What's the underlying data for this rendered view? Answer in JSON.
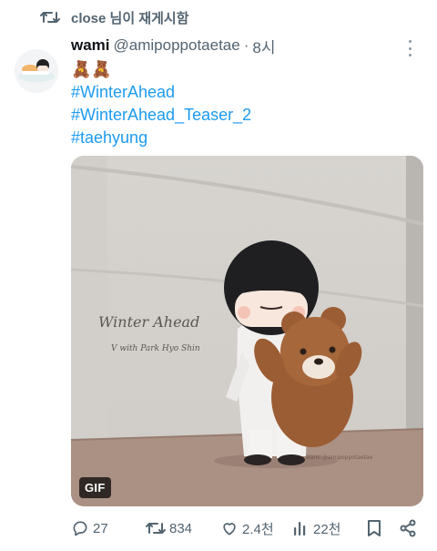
{
  "repost": {
    "text": "close 님이 재게시함"
  },
  "tweet": {
    "author_name": "wami",
    "handle": "@amipoppotaetae",
    "separator": "·",
    "time": "8시",
    "emoji": "🧸🧸",
    "hashtags": [
      "#WinterAhead",
      "#WinterAhead_Teaser_2",
      "#taehyung"
    ]
  },
  "media": {
    "badge": "GIF",
    "wall_title": "Winter Ahead",
    "wall_subtitle": "V with Park Hyo Shin",
    "watermark": "wami\n@amipoppotaetae"
  },
  "actions": {
    "replies": "27",
    "reposts": "834",
    "likes": "2.4천",
    "views": "22천"
  },
  "colors": {
    "hashtag": "#1d9bf0",
    "secondary_text": "#536471",
    "icon_gray": "#536471"
  }
}
